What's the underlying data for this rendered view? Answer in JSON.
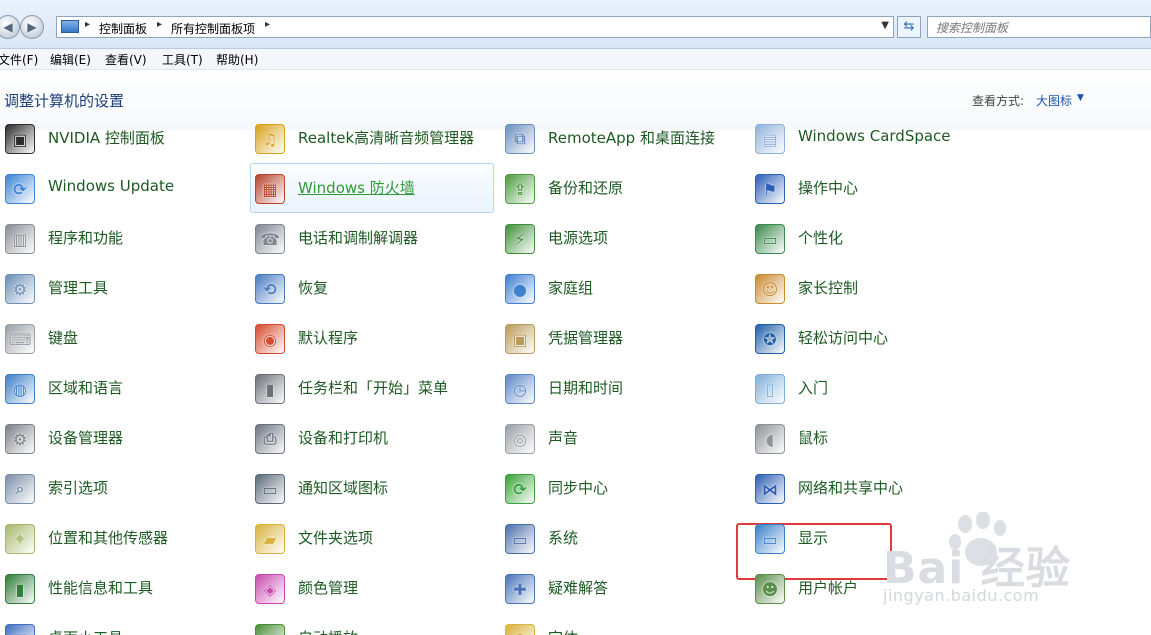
{
  "addressbar": {
    "crumbs": [
      "控制面板",
      "所有控制面板项"
    ],
    "search_placeholder": "搜索控制面板"
  },
  "menubar": [
    "文件(F)",
    "编辑(E)",
    "查看(V)",
    "工具(T)",
    "帮助(H)"
  ],
  "header": {
    "title": "调整计算机的设置",
    "view_by_label": "查看方式:",
    "view_by_value": "大图标"
  },
  "colors": {
    "label_text": "#1c5a22",
    "hover_text": "#2e9b37",
    "highlight_border": "#e03a3a"
  },
  "items": [
    {
      "label": "NVIDIA 控制面板",
      "icon": "nvidia-icon"
    },
    {
      "label": "Realtek高清晰音频管理器",
      "icon": "realtek-audio-icon"
    },
    {
      "label": "RemoteApp 和桌面连接",
      "icon": "remoteapp-icon"
    },
    {
      "label": "Windows CardSpace",
      "icon": "cardspace-icon"
    },
    {
      "label": "Windows Update",
      "icon": "windows-update-icon"
    },
    {
      "label": "Windows 防火墙",
      "icon": "firewall-icon",
      "state": "hover"
    },
    {
      "label": "备份和还原",
      "icon": "backup-icon"
    },
    {
      "label": "操作中心",
      "icon": "action-center-flag-icon"
    },
    {
      "label": "程序和功能",
      "icon": "programs-icon"
    },
    {
      "label": "电话和调制解调器",
      "icon": "phone-modem-icon"
    },
    {
      "label": "电源选项",
      "icon": "power-options-icon"
    },
    {
      "label": "个性化",
      "icon": "personalization-icon"
    },
    {
      "label": "管理工具",
      "icon": "admin-tools-icon"
    },
    {
      "label": "恢复",
      "icon": "recovery-icon"
    },
    {
      "label": "家庭组",
      "icon": "homegroup-icon"
    },
    {
      "label": "家长控制",
      "icon": "parental-controls-icon"
    },
    {
      "label": "键盘",
      "icon": "keyboard-icon"
    },
    {
      "label": "默认程序",
      "icon": "default-programs-icon"
    },
    {
      "label": "凭据管理器",
      "icon": "credential-manager-icon"
    },
    {
      "label": "轻松访问中心",
      "icon": "ease-of-access-icon"
    },
    {
      "label": "区域和语言",
      "icon": "region-language-icon"
    },
    {
      "label": "任务栏和「开始」菜单",
      "icon": "taskbar-icon"
    },
    {
      "label": "日期和时间",
      "icon": "date-time-icon"
    },
    {
      "label": "入门",
      "icon": "getting-started-icon"
    },
    {
      "label": "设备管理器",
      "icon": "device-manager-icon"
    },
    {
      "label": "设备和打印机",
      "icon": "devices-printers-icon"
    },
    {
      "label": "声音",
      "icon": "sound-icon"
    },
    {
      "label": "鼠标",
      "icon": "mouse-icon",
      "state": "highlighted"
    },
    {
      "label": "索引选项",
      "icon": "indexing-icon"
    },
    {
      "label": "通知区域图标",
      "icon": "notification-area-icon"
    },
    {
      "label": "同步中心",
      "icon": "sync-center-icon"
    },
    {
      "label": "网络和共享中心",
      "icon": "network-sharing-icon"
    },
    {
      "label": "位置和其他传感器",
      "icon": "location-sensors-icon"
    },
    {
      "label": "文件夹选项",
      "icon": "folder-options-icon"
    },
    {
      "label": "系统",
      "icon": "system-icon"
    },
    {
      "label": "显示",
      "icon": "display-icon"
    },
    {
      "label": "性能信息和工具",
      "icon": "performance-icon"
    },
    {
      "label": "颜色管理",
      "icon": "color-management-icon"
    },
    {
      "label": "疑难解答",
      "icon": "troubleshooting-icon"
    },
    {
      "label": "用户帐户",
      "icon": "user-accounts-icon"
    },
    {
      "label": "桌面小工具",
      "icon": "desktop-gadgets-icon"
    },
    {
      "label": "自动播放",
      "icon": "autoplay-icon"
    },
    {
      "label": "字体",
      "icon": "fonts-icon"
    }
  ],
  "watermark": {
    "brand": "Bai 经验",
    "url": "jingyan.baidu.com"
  }
}
